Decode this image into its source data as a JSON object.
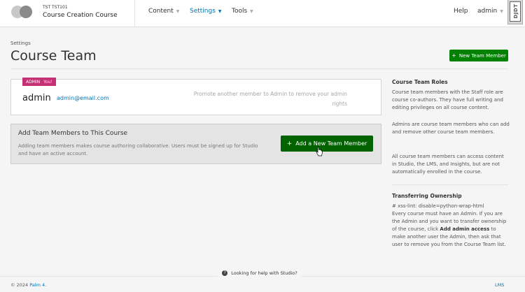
{
  "header": {
    "course_org": "TST TST101",
    "course_title": "Course Creation Course",
    "nav": {
      "content": "Content",
      "settings": "Settings",
      "tools": "Tools",
      "help": "Help",
      "admin": "admin"
    },
    "dudt_label": "DJDT"
  },
  "page": {
    "breadcrumb": "Settings",
    "title": "Course Team",
    "new_member_button": "New Team Member"
  },
  "member": {
    "badge": "ADMIN",
    "badge_you": "You!",
    "name": "admin",
    "email": "admin@email.com",
    "promote_note": "Promote another member to Admin to remove your admin rights"
  },
  "add_section": {
    "title": "Add Team Members to This Course",
    "description": "Adding team members makes course authoring collaborative. Users must be signed up for Studio and have an active account.",
    "button": "Add a New Team Member"
  },
  "sidebar": {
    "roles_title": "Course Team Roles",
    "roles_p1": "Course team members with the Staff role are course co-authors. They have full writing and editing privileges on all course content.",
    "roles_p2": "Admins are course team members who can add and remove other course team members.",
    "roles_p3": "All course team members can access content in Studio, the LMS, and Insights, but are not automatically enrolled in the course.",
    "transfer_title": "Transferring Ownership",
    "transfer_lint": "# xss-lint: disable=python-wrap-html",
    "transfer_pre": "Every course must have an Admin. If you are the Admin and you want to transfer ownership of the course, click",
    "transfer_bold": "Add admin access",
    "transfer_post": "to make another user the Admin, then ask that user to remove you from the Course Team list."
  },
  "footer": {
    "help_text": "Looking for help with Studio?",
    "copyright_prefix": "© 2024",
    "copyright_link": "Palm 4.",
    "lms_link": "LMS"
  },
  "colors": {
    "primary_green": "#008100",
    "link_blue": "#0075b4",
    "admin_badge": "#c43174"
  }
}
